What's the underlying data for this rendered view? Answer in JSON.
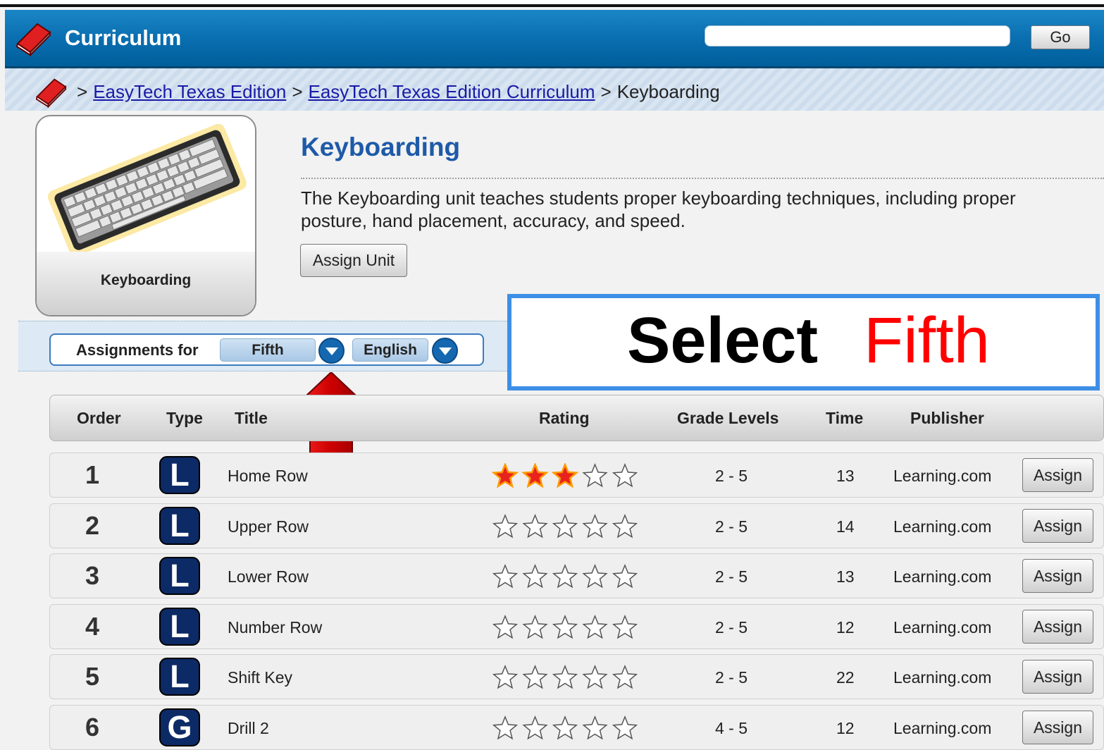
{
  "header": {
    "title": "Curriculum",
    "search_value": "",
    "go_label": "Go"
  },
  "breadcrumb": {
    "items": [
      "EasyTech Texas Edition",
      "EasyTech Texas Edition Curriculum",
      "Keyboarding"
    ],
    "separator": ">"
  },
  "unit": {
    "tile_caption": "Keyboarding",
    "title": "Keyboarding",
    "description_line1": "The Keyboarding unit teaches students proper keyboarding techniques, including proper",
    "description_line2": "posture, hand placement, accuracy, and speed.",
    "assign_unit_label": "Assign Unit"
  },
  "filter": {
    "label": "Assignments for",
    "grade_selected": "Fifth",
    "language_selected": "English"
  },
  "callout": {
    "word1": "Select",
    "word2": "Fifth",
    "word2_color": "#ff0000"
  },
  "table": {
    "headers": [
      "Order",
      "Type",
      "Title",
      "Rating",
      "Grade Levels",
      "Time",
      "Publisher"
    ],
    "assign_label": "Assign",
    "rows": [
      {
        "order": "1",
        "type": "L",
        "title": "Home Row",
        "rating": 3,
        "grades": "2 - 5",
        "time": "13",
        "publisher": "Learning.com"
      },
      {
        "order": "2",
        "type": "L",
        "title": "Upper Row",
        "rating": 0,
        "grades": "2 - 5",
        "time": "14",
        "publisher": "Learning.com"
      },
      {
        "order": "3",
        "type": "L",
        "title": "Lower Row",
        "rating": 0,
        "grades": "2 - 5",
        "time": "13",
        "publisher": "Learning.com"
      },
      {
        "order": "4",
        "type": "L",
        "title": "Number Row",
        "rating": 0,
        "grades": "2 - 5",
        "time": "12",
        "publisher": "Learning.com"
      },
      {
        "order": "5",
        "type": "L",
        "title": "Shift Key",
        "rating": 0,
        "grades": "2 - 5",
        "time": "22",
        "publisher": "Learning.com"
      },
      {
        "order": "6",
        "type": "G",
        "title": "Drill 2",
        "rating": 0,
        "grades": "4 - 5",
        "time": "12",
        "publisher": "Learning.com"
      }
    ],
    "rating_max": 5
  },
  "colors": {
    "header_blue": "#0a6fb0",
    "title_blue": "#1e5aa8",
    "type_icon": "#0c2a66",
    "arrow_red": "#cc0000"
  }
}
